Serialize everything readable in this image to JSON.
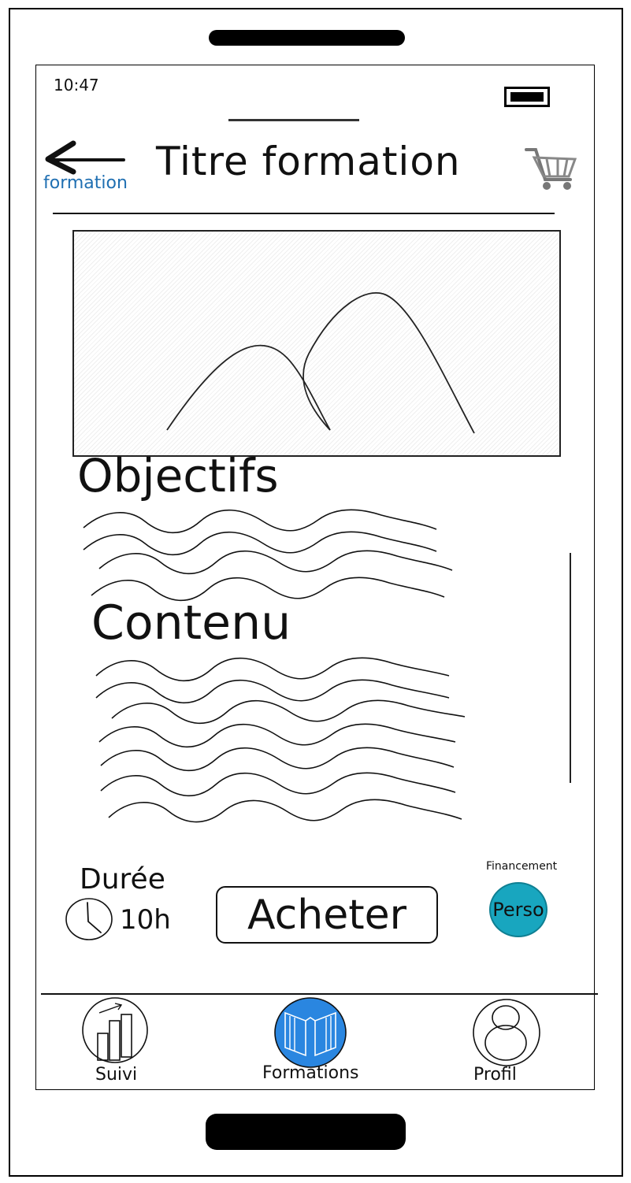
{
  "status_bar": {
    "time": "10:47"
  },
  "header": {
    "back_label": "formation",
    "title": "Titre formation"
  },
  "sections": {
    "objectives_title": "Objectifs",
    "content_title": "Contenu"
  },
  "info": {
    "duration_label": "Durée",
    "duration_value": "10h",
    "buy_label": "Acheter",
    "funding_label": "Financement",
    "funding_value": "Perso"
  },
  "tabs": [
    {
      "label": "Suivi",
      "icon": "chart-icon",
      "active": false
    },
    {
      "label": "Formations",
      "icon": "book-icon",
      "active": true
    },
    {
      "label": "Profil",
      "icon": "person-icon",
      "active": false
    }
  ],
  "colors": {
    "link": "#1f6fb2",
    "active_tab": "#2a86e0",
    "funding_badge": "#18a6bf"
  }
}
